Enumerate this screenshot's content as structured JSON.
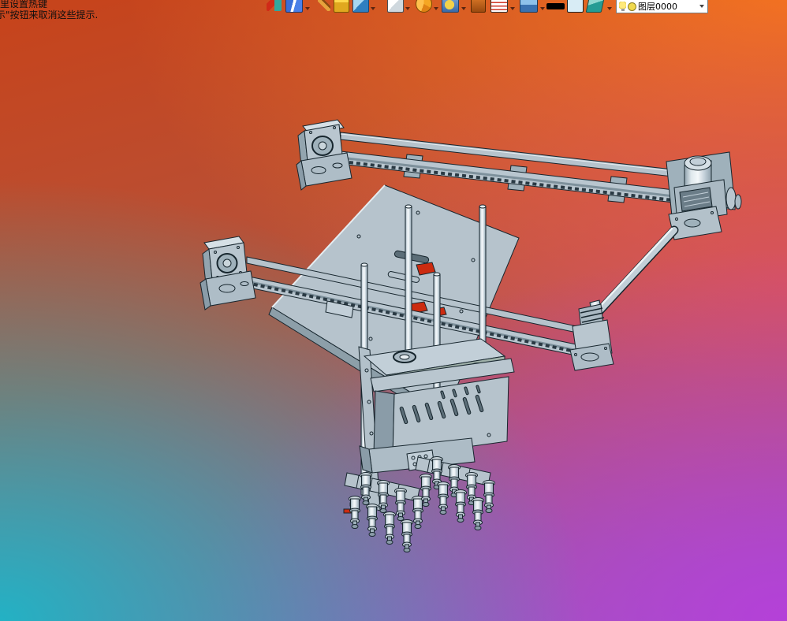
{
  "hint": {
    "line1": "里设置热键",
    "line2": "示\"按钮来取消这些提示."
  },
  "toolbar": {
    "icons": [
      {
        "name": "exit-door-icon"
      },
      {
        "name": "notebook-icon",
        "has_dropdown": true
      },
      {
        "name": "pen-icon"
      },
      {
        "name": "yellow-box-icon"
      },
      {
        "name": "blue-cube-icon",
        "has_dropdown": true
      },
      {
        "name": "white-cube-icon",
        "has_dropdown": true
      },
      {
        "name": "pie-wedge-icon",
        "has_dropdown": true
      },
      {
        "name": "render-view-icon",
        "has_dropdown": true
      },
      {
        "name": "material-icon"
      },
      {
        "name": "drawing-sheet-icon",
        "has_dropdown": true
      },
      {
        "name": "display-settings-icon",
        "has_dropdown": true
      },
      {
        "name": "line-width-swatch"
      },
      {
        "name": "color-swatch"
      },
      {
        "name": "layers-icon",
        "has_dropdown": true
      }
    ],
    "layer_selector": {
      "value": "图层0000",
      "icons": [
        "bulb-icon",
        "layer-color-icon"
      ]
    }
  },
  "canvas": {
    "model": "gantry-pick-and-place-assembly",
    "background_colors": {
      "top_left": "#c7431a",
      "top_right": "#f5741f",
      "mid_right": "#dd4f64",
      "bottom_left": "#1cb6c8",
      "bottom_right": "#b83ddb"
    },
    "model_colors": {
      "body": "#b9c6cf",
      "shadow": "#8a9ca8",
      "edge": "#17262e",
      "cutout_red": "#cc2b10"
    }
  }
}
